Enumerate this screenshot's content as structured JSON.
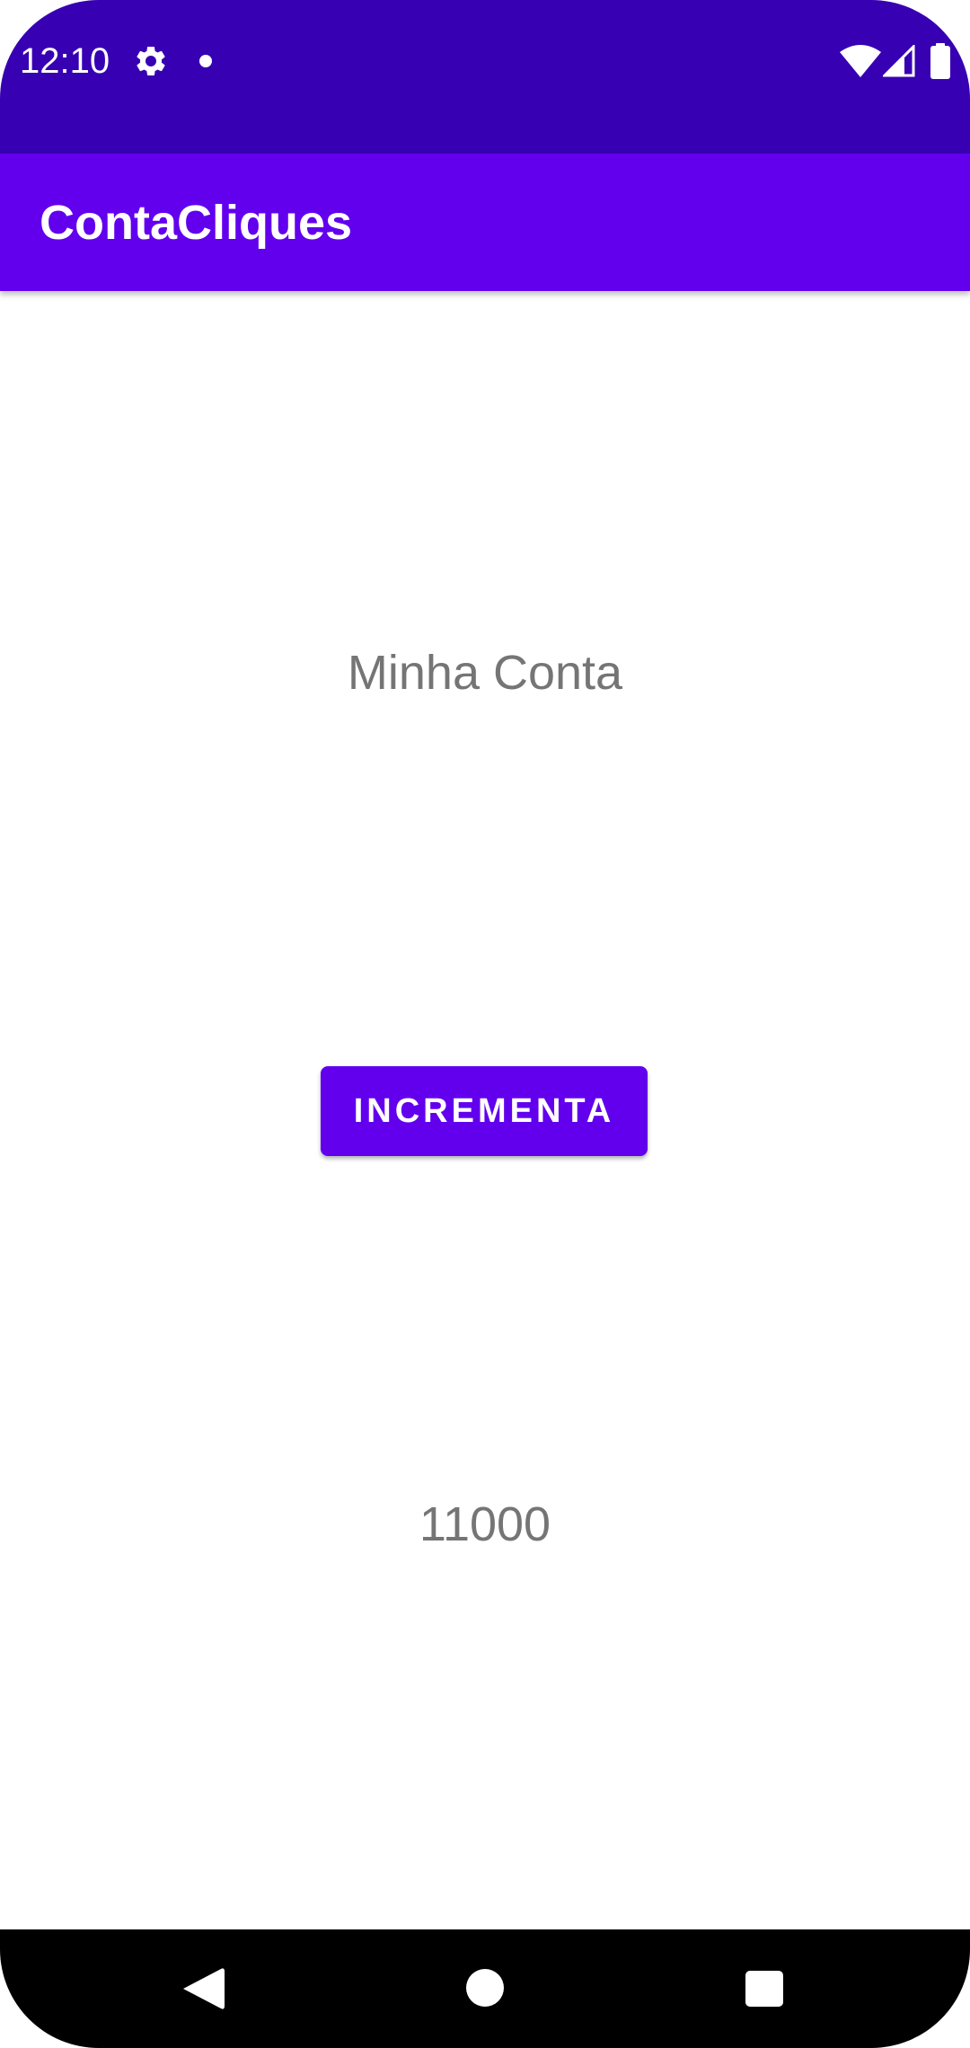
{
  "status_bar": {
    "time": "12:10",
    "icons": [
      "gear-icon",
      "notification-dot-icon",
      "wifi-icon",
      "signal-icon",
      "battery-icon"
    ],
    "background_color": "#3700b3"
  },
  "app_bar": {
    "title": "ContaCliques",
    "background_color": "#6200ee"
  },
  "main": {
    "label": "Minha Conta",
    "button_label": "INCREMENTA",
    "counter_value": "11000",
    "accent_color": "#6200ee",
    "text_color": "#757575"
  },
  "nav_bar": {
    "icons": [
      "back-icon",
      "home-icon",
      "recents-icon"
    ]
  }
}
